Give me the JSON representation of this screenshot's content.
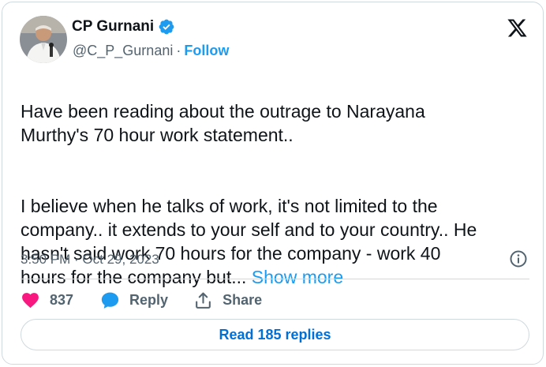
{
  "author": {
    "display_name": "CP Gurnani",
    "handle": "@C_P_Gurnani",
    "separator": "·",
    "follow_label": "Follow",
    "avatar_icon": "user-portrait-avatar"
  },
  "platform_icon": "x-logo-icon",
  "tweet": {
    "paragraph_1": "Have been reading about the outrage to Narayana\nMurthy's 70 hour work statement..",
    "paragraph_2": "I believe when he talks of work, it's not limited to the\ncompany.. it extends to your self and to your country..  He\nhasn't said work 70 hours for the company - work 40\nhours for the company but... ",
    "show_more_label": "Show more",
    "timestamp": "3:50 PM · Oct 29, 2023"
  },
  "actions": {
    "like_count": "837",
    "reply_label": "Reply",
    "share_label": "Share"
  },
  "read_replies_label": "Read 185 replies",
  "colors": {
    "accent": "#1d9bf0",
    "like": "#f91880",
    "secondary_text": "#536471",
    "border": "#cfd9de"
  }
}
